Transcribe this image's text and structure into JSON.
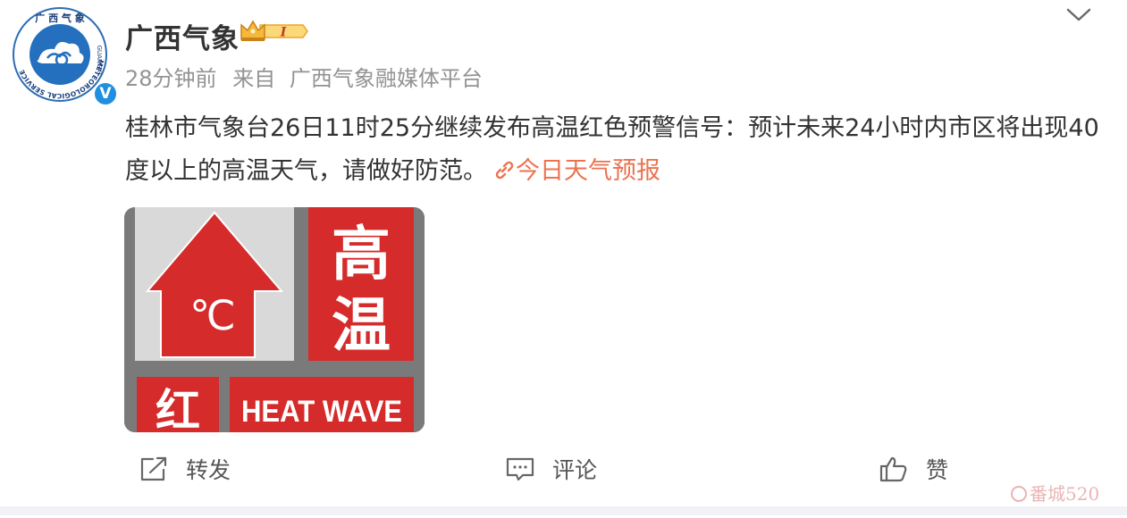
{
  "header": {
    "username": "广西气象",
    "vip_level": "I",
    "time": "28分钟前",
    "source_prefix": "来自",
    "source": "广西气象融媒体平台",
    "avatar_ring_text": "METEOROLOGICAL SERVICE",
    "avatar_top_text": "广 西 气 象",
    "avatar_right_text": "GUANGXI",
    "verified": "V"
  },
  "post": {
    "text": "桂林市气象台26日11时25分继续发布高温红色预警信号：预计未来24小时内市区将出现40度以上的高温天气，请做好防范。",
    "link_label": "今日天气预报"
  },
  "warning_image": {
    "symbol": "℃",
    "title_line1": "高",
    "title_line2": "温",
    "level": "红",
    "english": "HEAT WAVE"
  },
  "actions": {
    "repost": "转发",
    "comment": "评论",
    "like": "赞"
  },
  "watermark": {
    "brand": "番城520"
  },
  "colors": {
    "link": "#eb7350",
    "warning_red": "#d42b2b",
    "verified_blue": "#1e8fe1",
    "vip_gold": "#f6b83a"
  }
}
